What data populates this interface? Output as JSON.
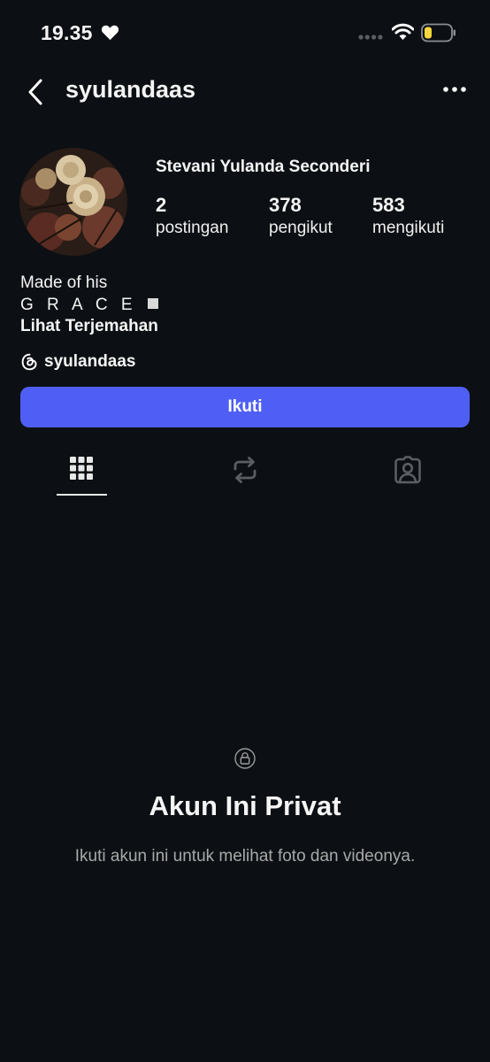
{
  "status_bar": {
    "time": "19.35",
    "icons": [
      "heart-icon",
      "signal-icon",
      "wifi-icon",
      "battery-icon"
    ]
  },
  "header": {
    "username": "syulandaas",
    "back_icon": "chevron-left-icon",
    "more_icon": "more-horizontal-icon"
  },
  "profile": {
    "full_name": "Stevani Yulanda Seconderi",
    "stats": {
      "posts": {
        "value": "2",
        "label": "postingan"
      },
      "followers": {
        "value": "378",
        "label": "pengikut"
      },
      "following": {
        "value": "583",
        "label": "mengikuti"
      }
    },
    "bio_line1": "Made of his",
    "bio_line2": "G R A C E",
    "translate_label": "Lihat Terjemahan",
    "threads_handle": "syulandaas"
  },
  "follow_button": {
    "label": "Ikuti",
    "color": "#4f5ff5"
  },
  "tabs": [
    {
      "icon": "grid-icon",
      "active": true
    },
    {
      "icon": "reels-repost-icon",
      "active": false
    },
    {
      "icon": "tagged-icon",
      "active": false
    }
  ],
  "private": {
    "icon": "lock-icon",
    "title": "Akun Ini Privat",
    "subtitle": "Ikuti akun ini untuk melihat foto dan videonya."
  },
  "colors": {
    "background": "#0c1014",
    "accent": "#4f5ff5",
    "secondary_text": "#a8a8a8"
  }
}
